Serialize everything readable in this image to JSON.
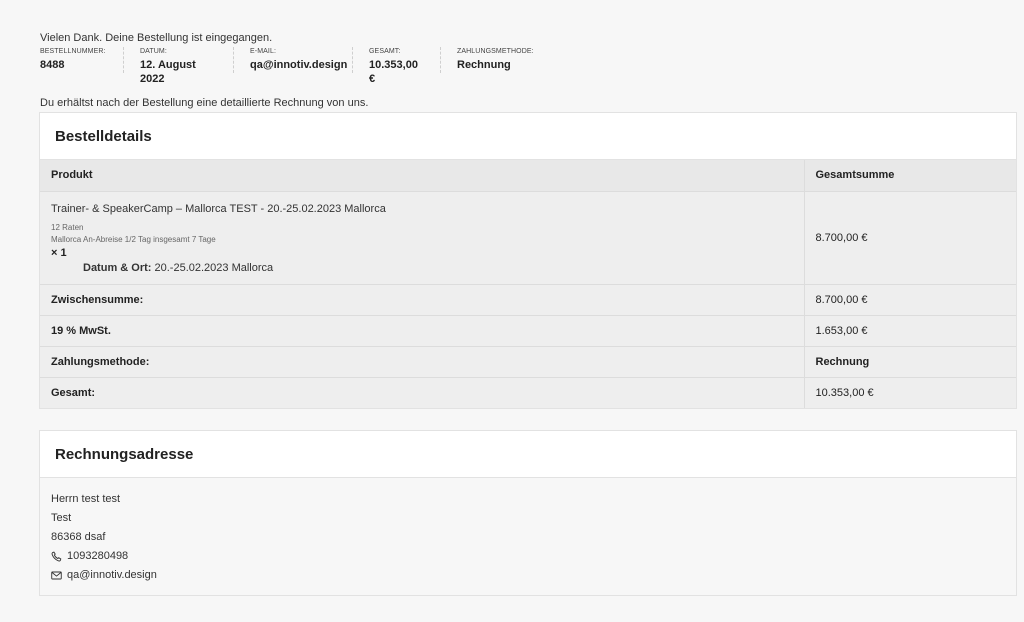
{
  "thanks_message": "Vielen Dank. Deine Bestellung ist eingegangen.",
  "overview": [
    {
      "label": "Bestellnummer:",
      "value": "8488"
    },
    {
      "label": "Datum:",
      "value": "12. August 2022"
    },
    {
      "label": "E-Mail:",
      "value": "qa@innotiv.design"
    },
    {
      "label": "Gesamt:",
      "value": "10.353,00 €"
    },
    {
      "label": "Zahlungsmethode:",
      "value": "Rechnung"
    }
  ],
  "invoice_note": "Du erhältst nach der Bestellung eine detaillierte Rechnung von uns.",
  "order_details": {
    "title": "Bestelldetails",
    "col_product": "Produkt",
    "col_total": "Gesamtsumme",
    "item": {
      "name": "Trainer- & SpeakerCamp – Mallorca TEST - 20.-25.02.2023 Mallorca",
      "meta_1": "12 Raten",
      "meta_2": "Mallorca An-Abreise 1/2 Tag insgesamt 7 Tage",
      "qty": "× 1",
      "date_label": "Datum & Ort:",
      "date_value": "20.-25.02.2023 Mallorca",
      "total": "8.700,00 €"
    },
    "rows": [
      {
        "label": "Zwischensumme:",
        "value": "8.700,00 €"
      },
      {
        "label": "19 % MwSt.",
        "value": "1.653,00 €"
      },
      {
        "label": "Zahlungsmethode:",
        "value": "Rechnung"
      },
      {
        "label": "Gesamt:",
        "value": "10.353,00 €"
      }
    ]
  },
  "billing": {
    "title": "Rechnungsadresse",
    "name": "Herrn test test",
    "company": "Test",
    "city": "86368 dsaf",
    "phone": "1093280498",
    "email": "qa@innotiv.design",
    "phone_icon": "phone-icon",
    "email_icon": "envelope-icon"
  }
}
